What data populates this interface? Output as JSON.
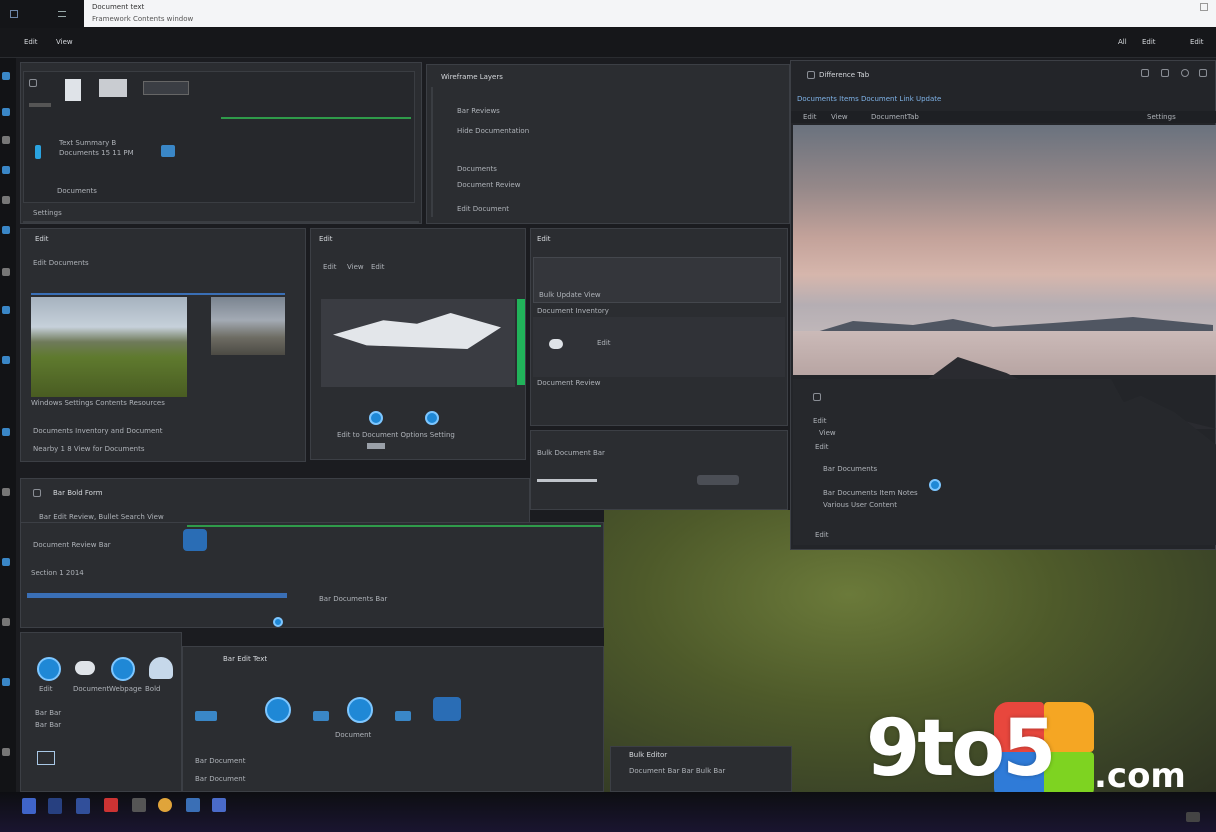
{
  "titlebar": {
    "title": "Document text",
    "subtitle": "Framework  Contents window"
  },
  "menubar": {
    "items": [
      "Edit",
      "View"
    ],
    "right_items": [
      "All",
      "Edit",
      "Edit"
    ]
  },
  "watermark": {
    "brand": "9to5",
    "tld": ".com",
    "colors": [
      "#e8473d",
      "#f5a623",
      "#7ed321",
      "#2f7bd8"
    ]
  },
  "panels": {
    "p1": {
      "lines": [
        "Text Summary B",
        "Documents 15 11 PM",
        "Documents"
      ],
      "tabs": [
        "Settings",
        "Settings"
      ]
    },
    "p2": {
      "title": "Wireframe Layers",
      "items": [
        "Bar Reviews",
        "Hide Documentation",
        "Documents",
        "Document Review",
        "Edit Document"
      ]
    },
    "viewer": {
      "title": "Difference Tab",
      "subtitle": "Documents Items Document Link Update",
      "menu": [
        "Edit",
        "View",
        "Document",
        "Tab",
        "Settings"
      ],
      "list": [
        "Bar Documents",
        "Bar Documents Item Notes",
        "Various User Content"
      ],
      "label1": "Edit",
      "label2": "View",
      "label3": "Edit",
      "footer": "Edit"
    },
    "p3": {
      "title": "Edit",
      "sub": "Edit Documents",
      "caption": "Windows Settings Contents Resources",
      "line1": "Documents Inventory and Document",
      "line2": "Nearby 1 8 View for Documents"
    },
    "p4": {
      "title": "Edit",
      "labels": [
        "Edit",
        "View",
        "Edit"
      ],
      "caption": "Edit to Document Options Setting"
    },
    "p5": {
      "title": "Edit",
      "sub": "Bulk Update View",
      "sub2": "Document Inventory",
      "tab": "Edit",
      "title2": "Document Review",
      "line": "Bulk Document Bar"
    },
    "p6": {
      "title": "Bar Bold Form",
      "line": "Bar Edit Review, Bullet Search View",
      "sub": "Document Review Bar",
      "sub2": "Section 1 2014",
      "task": "Bar Documents Bar"
    },
    "p7": {
      "labels": [
        "Edit",
        "Document",
        "Webpage",
        "Bold"
      ],
      "sub": "Bar Bar",
      "sub2": "Bar Bar",
      "title": "Bar Edit Text",
      "caption": "Document",
      "list": [
        "Bar Document",
        "Bar Document"
      ]
    },
    "p8": {
      "title": "Bulk Editor",
      "line": "Document Bar Bar Bulk Bar"
    }
  },
  "taskbar": {
    "apps": [
      "app-1",
      "app-2",
      "app-3",
      "app-4",
      "app-5",
      "app-6",
      "app-7",
      "app-8",
      "app-9"
    ]
  }
}
